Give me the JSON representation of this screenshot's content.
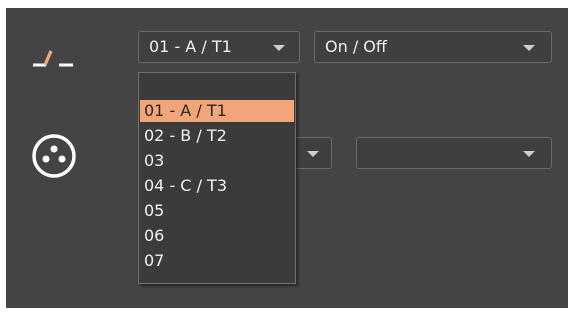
{
  "row1": {
    "channel_select": {
      "value": "01 - A / T1"
    },
    "mode_select": {
      "value": "On / Off"
    }
  },
  "row2": {
    "select_a": {
      "value": ""
    },
    "select_b": {
      "value": ""
    }
  },
  "channel_dropdown": {
    "options": [
      "",
      "01 - A / T1",
      "02 - B / T2",
      "03",
      "04 - C / T3",
      "05",
      "06",
      "07"
    ],
    "selected_index": 1
  },
  "icons": [
    "switch-icon",
    "xlr-connector-icon"
  ],
  "colors": {
    "panel_bg": "#444444",
    "highlight": "#f3a57a",
    "text": "#f0f0f0"
  }
}
